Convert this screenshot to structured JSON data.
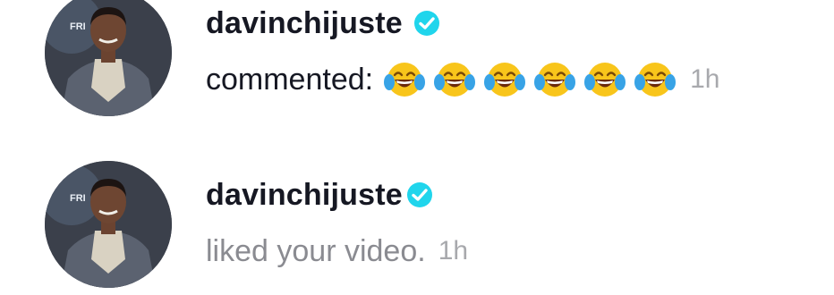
{
  "notifications": [
    {
      "username": "davinchijuste",
      "verified": true,
      "action": "commented:",
      "emojis": [
        "face-with-tears-of-joy",
        "face-with-tears-of-joy",
        "face-with-tears-of-joy",
        "face-with-tears-of-joy",
        "face-with-tears-of-joy",
        "face-with-tears-of-joy"
      ],
      "time": "1h"
    },
    {
      "username": "davinchijuste",
      "verified": true,
      "action": "liked your video.",
      "time": "1h"
    }
  ],
  "colors": {
    "text": "#161823",
    "muted": "#8a8b91",
    "time": "#a8a9ad",
    "verified": "#20d5ec",
    "avatar_bg": "#3a3f4a"
  }
}
